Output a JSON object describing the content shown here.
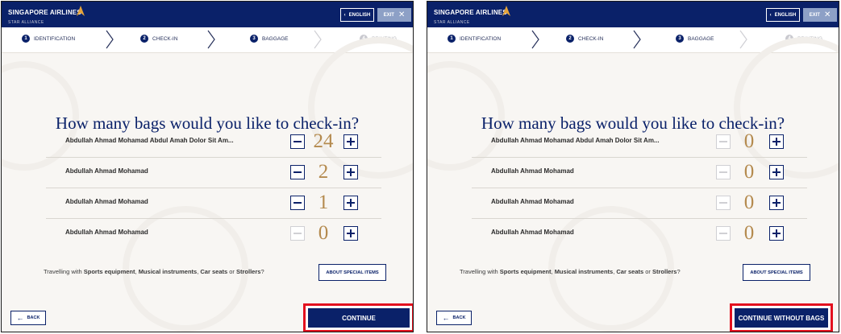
{
  "panels": [
    {
      "header": {
        "airline": "SINGAPORE AIRLINES",
        "alliance": "STAR ALLIANCE",
        "language_label": "ENGLISH",
        "exit_label": "EXIT"
      },
      "steps": [
        {
          "number": "1",
          "label": "IDENTIFICATION"
        },
        {
          "number": "2",
          "label": "CHECK-IN"
        },
        {
          "number": "3",
          "label": "BAGGAGE"
        },
        {
          "number": "4",
          "label": "PRINTING"
        }
      ],
      "title": "How many bags would you like to check-in?",
      "passengers": [
        {
          "name": "Abdullah Ahmad Mohamad Abdul Amah Dolor Sit Am...",
          "bags": "24",
          "minus_enabled": true
        },
        {
          "name": "Abdullah Ahmad Mohamad",
          "bags": "2",
          "minus_enabled": true
        },
        {
          "name": "Abdullah Ahmad Mohamad",
          "bags": "1",
          "minus_enabled": true
        },
        {
          "name": "Abdullah Ahmad Mohamad",
          "bags": "0",
          "minus_enabled": false
        }
      ],
      "special": {
        "prefix": "Travelling with ",
        "item1": "Sports equipment",
        "sep1": ", ",
        "item2": "Musical instruments",
        "sep2": ", ",
        "item3": "Car seats",
        "sep3": " or ",
        "item4": "Strollers",
        "suffix": "?",
        "button": "ABOUT SPECIAL ITEMS"
      },
      "back_label": "BACK",
      "continue_label": "CONTINUE"
    },
    {
      "header": {
        "airline": "SINGAPORE AIRLINES",
        "alliance": "STAR ALLIANCE",
        "language_label": "ENGLISH",
        "exit_label": "EXIT"
      },
      "steps": [
        {
          "number": "1",
          "label": "IDENTIFICATION"
        },
        {
          "number": "2",
          "label": "CHECK-IN"
        },
        {
          "number": "3",
          "label": "BAGGAGE"
        },
        {
          "number": "4",
          "label": "PRINTING"
        }
      ],
      "title": "How many bags would you like to check-in?",
      "passengers": [
        {
          "name": "Abdullah Ahmad Mohamad Abdul Amah Dolor Sit Am...",
          "bags": "0",
          "minus_enabled": false
        },
        {
          "name": "Abdullah Ahmad Mohamad",
          "bags": "0",
          "minus_enabled": false
        },
        {
          "name": "Abdullah Ahmad Mohamad",
          "bags": "0",
          "minus_enabled": false
        },
        {
          "name": "Abdullah Ahmad Mohamad",
          "bags": "0",
          "minus_enabled": false
        }
      ],
      "special": {
        "prefix": "Travelling with ",
        "item1": "Sports equipment",
        "sep1": ", ",
        "item2": "Musical instruments",
        "sep2": ", ",
        "item3": "Car seats",
        "sep3": " or ",
        "item4": "Strollers",
        "suffix": "?",
        "button": "ABOUT SPECIAL ITEMS"
      },
      "back_label": "BACK",
      "continue_label": "CONTINUE WITHOUT BAGS"
    }
  ],
  "colors": {
    "brand_navy": "#0a2169",
    "gold": "#b48a4e",
    "highlight_red": "#e3101e",
    "exit_blue": "#8da0c6"
  }
}
